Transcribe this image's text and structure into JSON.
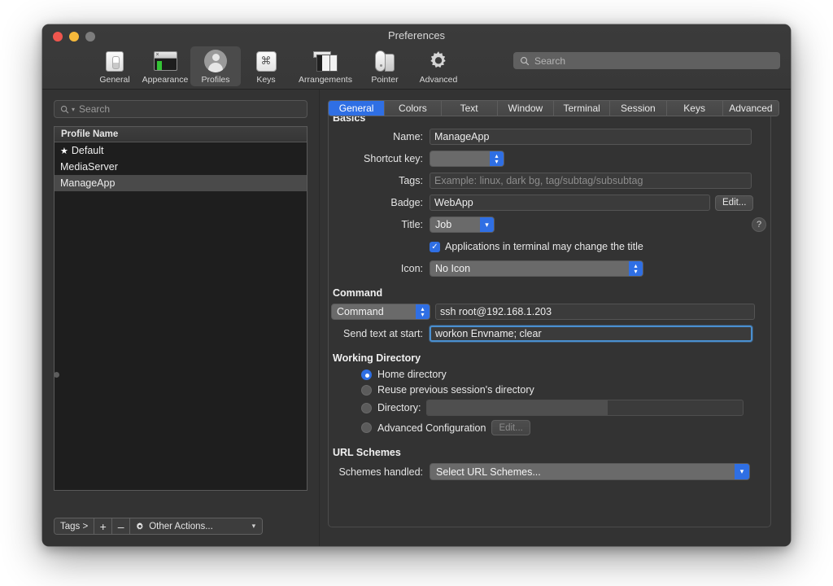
{
  "window": {
    "title": "Preferences",
    "traffic_lights": [
      "close-button",
      "minimize-button",
      "zoom-button"
    ]
  },
  "toolbar": {
    "items": [
      {
        "label": "General",
        "icon": "general-icon",
        "selected": false
      },
      {
        "label": "Appearance",
        "icon": "appearance-icon",
        "selected": false
      },
      {
        "label": "Profiles",
        "icon": "profiles-icon",
        "selected": true
      },
      {
        "label": "Keys",
        "icon": "keys-icon",
        "selected": false
      },
      {
        "label": "Arrangements",
        "icon": "arrangements-icon",
        "selected": false
      },
      {
        "label": "Pointer",
        "icon": "pointer-icon",
        "selected": false
      },
      {
        "label": "Advanced",
        "icon": "advanced-gear-icon",
        "selected": false
      }
    ],
    "search_placeholder": "Search",
    "search_value": ""
  },
  "sidebar": {
    "search_placeholder": "Search",
    "search_value": "",
    "column_header": "Profile Name",
    "profiles": [
      {
        "name": "Default",
        "is_default": true,
        "selected": false
      },
      {
        "name": "MediaServer",
        "is_default": false,
        "selected": false
      },
      {
        "name": "ManageApp",
        "is_default": false,
        "selected": true
      }
    ],
    "actions": {
      "tags_label": "Tags >",
      "add_label": "+",
      "remove_label": "–",
      "other_actions_label": "Other Actions..."
    }
  },
  "tabs": [
    {
      "label": "General",
      "active": true
    },
    {
      "label": "Colors",
      "active": false
    },
    {
      "label": "Text",
      "active": false
    },
    {
      "label": "Window",
      "active": false
    },
    {
      "label": "Terminal",
      "active": false
    },
    {
      "label": "Session",
      "active": false
    },
    {
      "label": "Keys",
      "active": false
    },
    {
      "label": "Advanced",
      "active": false
    }
  ],
  "general": {
    "basics_title": "Basics",
    "name_label": "Name:",
    "name_value": "ManageApp",
    "shortcut_label": "Shortcut key:",
    "shortcut_value": "",
    "tags_label": "Tags:",
    "tags_value": "",
    "tags_placeholder": "Example: linux, dark bg, tag/subtag/subsubtag",
    "badge_label": "Badge:",
    "badge_value": "WebApp",
    "badge_edit_label": "Edit...",
    "title_label": "Title:",
    "title_value": "Job",
    "help_label": "?",
    "apps_change_title_label": "Applications in terminal may change the title",
    "apps_change_title_checked": true,
    "icon_label": "Icon:",
    "icon_value": "No Icon",
    "command_title": "Command",
    "command_mode_value": "Command",
    "command_value": "ssh root@192.168.1.203",
    "send_text_label": "Send text at start:",
    "send_text_value": "workon Envname; clear",
    "working_dir_title": "Working Directory",
    "wd_home_label": "Home directory",
    "wd_reuse_label": "Reuse previous session's directory",
    "wd_directory_label": "Directory:",
    "wd_directory_value": "",
    "wd_advanced_label": "Advanced Configuration",
    "wd_advanced_edit_label": "Edit...",
    "wd_selected": "home",
    "url_schemes_title": "URL Schemes",
    "schemes_handled_label": "Schemes handled:",
    "schemes_handled_value": "Select URL Schemes..."
  },
  "colors": {
    "accent_blue": "#2f6fe4",
    "focus_ring": "#4a8fd0",
    "window_bg": "#333333",
    "titlebar_bg": "#3b3b3b",
    "list_bg": "#1e1e1e",
    "selection_bg": "#4a4a4a",
    "close_red": "#f0564e",
    "minimize_yellow": "#f6b93b",
    "zoom_grey": "#7d7d7d"
  }
}
